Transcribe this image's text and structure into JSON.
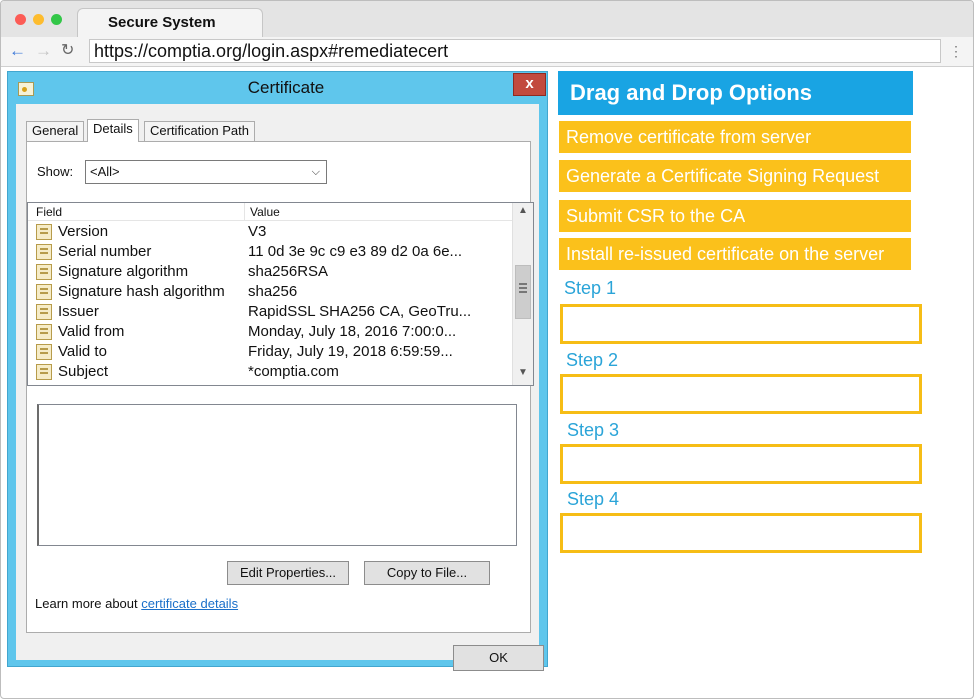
{
  "browser": {
    "tab_title": "Secure System",
    "url": "https://comptia.org/login.aspx#remediatecert",
    "icons": {
      "back": "arrow-left-icon",
      "forward": "arrow-right-icon",
      "reload": "reload-icon",
      "menu": "kebab-menu-icon"
    }
  },
  "dialog": {
    "title": "Certificate",
    "close_glyph": "x",
    "tabs": [
      "General",
      "Details",
      "Certification Path"
    ],
    "show_label": "Show:",
    "show_value": "<All>",
    "columns": {
      "field": "Field",
      "value": "Value"
    },
    "rows": [
      {
        "field": "Version",
        "value": "V3"
      },
      {
        "field": "Serial number",
        "value": "11 0d 3e 9c c9 e3 89 d2 0a 6e..."
      },
      {
        "field": "Signature algorithm",
        "value": "sha256RSA"
      },
      {
        "field": "Signature hash algorithm",
        "value": "sha256"
      },
      {
        "field": "Issuer",
        "value": "RapidSSL SHA256 CA, GeoTru..."
      },
      {
        "field": "Valid from",
        "value": "Monday, July 18, 2016 7:00:0..."
      },
      {
        "field": "Valid to",
        "value": "Friday, July 19, 2018 6:59:59..."
      },
      {
        "field": "Subject",
        "value": "*comptia.com"
      }
    ],
    "edit_properties": "Edit Properties...",
    "copy_to_file": "Copy to File...",
    "learn_more": "Learn more about",
    "learn_more_link": "certificate details",
    "ok": "OK"
  },
  "dragdrop": {
    "header": "Drag and Drop Options",
    "options": [
      "Remove certificate from server",
      "Generate a Certificate Signing Request",
      "Submit CSR to the CA",
      "Install re-issued certificate on the server"
    ],
    "steps": [
      "Step 1",
      "Step 2",
      "Step 3",
      "Step 4"
    ]
  },
  "colors": {
    "dialog_frame": "#5fc6ec",
    "header_blue": "#19a4e3",
    "option_yellow": "#fbc11b",
    "step_text": "#2aa4d8",
    "close_red": "#c24a3e"
  }
}
